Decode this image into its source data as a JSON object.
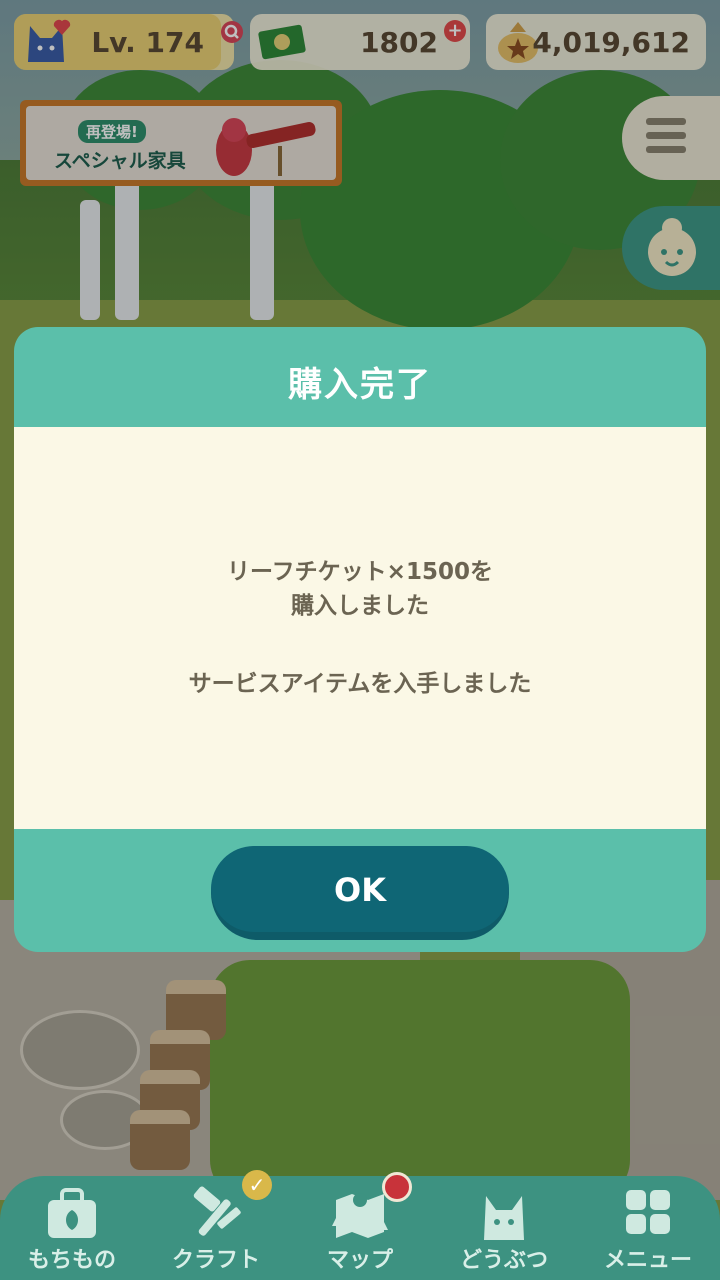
{
  "hud": {
    "level_label": "Lv. 174",
    "level_progress": 0.94,
    "leaf_tickets": "1802",
    "bells": "4,019,612"
  },
  "banner": {
    "tag": "再登場!",
    "title": "スペシャル家具"
  },
  "dialog": {
    "title": "購入完了",
    "message_line1": "リーフチケット×1500を",
    "message_line2": "購入しました",
    "message_line3": "サービスアイテムを入手しました",
    "ok_label": "OK"
  },
  "nav": {
    "items": [
      {
        "label": "もちもの",
        "icon": "bag-icon"
      },
      {
        "label": "クラフト",
        "icon": "craft-hammer-icon"
      },
      {
        "label": "マップ",
        "icon": "map-icon"
      },
      {
        "label": "どうぶつ",
        "icon": "animal-icon"
      },
      {
        "label": "メニュー",
        "icon": "menu-grid-icon"
      }
    ]
  },
  "colors": {
    "dialog_teal": "#5bbfaa",
    "dialog_body": "#fbf8e6",
    "ok_button": "#0f6675",
    "nav_bg": "#3d9281"
  }
}
